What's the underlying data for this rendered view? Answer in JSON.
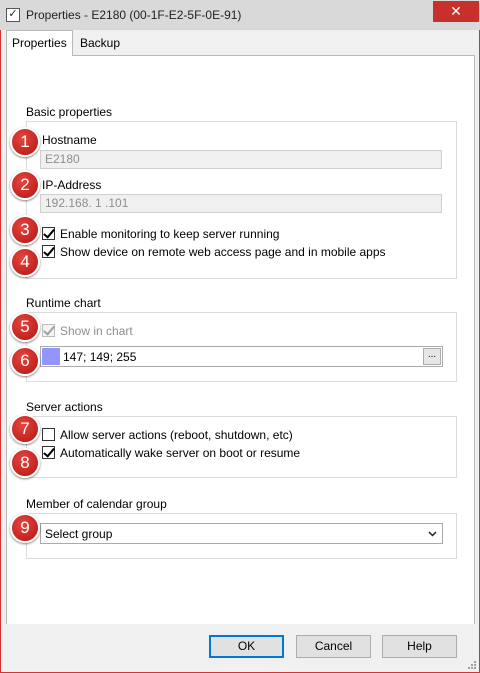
{
  "window": {
    "title": "Properties - E2180 (00-1F-E2-5F-0E-91)",
    "title_icon": "✓",
    "close_glyph": "✕"
  },
  "tabs": [
    {
      "label": "Properties",
      "active": true
    },
    {
      "label": "Backup",
      "active": false
    }
  ],
  "basic": {
    "title": "Basic properties",
    "hostname_label": "Hostname",
    "hostname_value": "E2180",
    "ip_label": "IP-Address",
    "ip_value": "192.168. 1 .101",
    "monitoring_label": "Enable monitoring to keep server running",
    "monitoring_checked": true,
    "show_device_label": "Show device on remote web access page and in mobile apps",
    "show_device_checked": true
  },
  "runtime": {
    "title": "Runtime chart",
    "show_in_chart_label": "Show in chart",
    "show_in_chart_checked": true,
    "color_value": "147; 149; 255",
    "color_hex": "#9395ff",
    "ellipsis": "..."
  },
  "server_actions": {
    "title": "Server actions",
    "allow_label": "Allow server actions (reboot, shutdown, etc)",
    "allow_checked": false,
    "wake_label": "Automatically wake server on boot or resume",
    "wake_checked": true
  },
  "calendar": {
    "title": "Member of calendar group",
    "selected": "Select group"
  },
  "badges": [
    "1",
    "2",
    "3",
    "4",
    "5",
    "6",
    "7",
    "8",
    "9"
  ],
  "buttons": {
    "ok": "OK",
    "cancel": "Cancel",
    "help": "Help"
  }
}
